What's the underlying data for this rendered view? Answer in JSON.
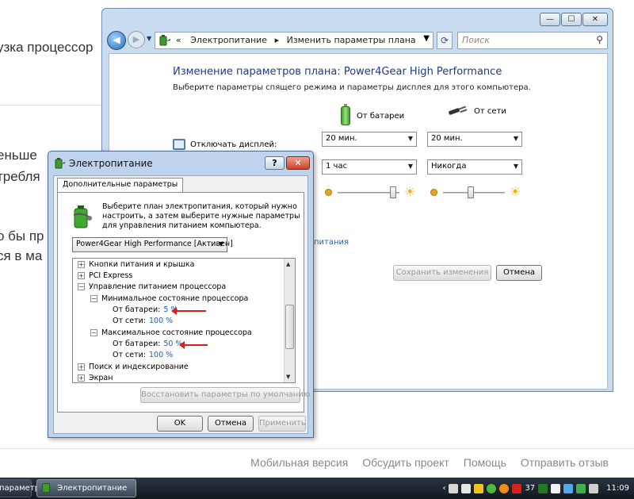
{
  "background_page": {
    "fragments": [
      "узка процессор",
      "еньше",
      "требля",
      "о бы пр",
      "ся в ма"
    ],
    "footer_links": [
      "Мобильная версия",
      "Обсудить проект",
      "Помощь",
      "Отправить отзыв"
    ]
  },
  "control_panel": {
    "caption_buttons": [
      "—",
      "☐",
      "✕"
    ],
    "breadcrumb_separator": "«",
    "address_items": [
      "Электропитание",
      "Изменить параметры плана"
    ],
    "address_arrow": "▸",
    "search_placeholder": "Поиск",
    "title": "Изменение параметров плана: Power4Gear High Performance",
    "subtitle": "Выберите параметры спящего режима и параметры дисплея для этого компьютера.",
    "col_battery": "От батареи",
    "col_ac": "От сети",
    "display_off_label": "Отключать дисплей:",
    "display_off_battery": "20 мин.",
    "display_off_ac": "20 мин.",
    "sleep_battery": "1 час",
    "sleep_ac": "Никогда",
    "brightness_battery_fraction": 0.9,
    "brightness_ac_fraction": 0.45,
    "partial_link": "питания",
    "save_button": "Сохранить изменения",
    "cancel_button": "Отмена"
  },
  "dialog": {
    "title": "Электропитание",
    "help_button": "?",
    "close_button": "✕",
    "tab": "Дополнительные параметры",
    "description": "Выберите план электропитания, который нужно настроить, а затем выберите нужные параметры для управления питанием компьютера.",
    "plan": "Power4Gear High Performance [Активен]",
    "tree": {
      "power_buttons": "Кнопки питания и крышка",
      "pci_express": "PCI Express",
      "cpu_management": "Управление питанием процессора",
      "min_state": "Минимальное состояние процессора",
      "min_battery_label": "От батареи:",
      "min_battery_value": "5 %",
      "min_ac_label": "От сети:",
      "min_ac_value": "100 %",
      "max_state": "Максимальное состояние процессора",
      "max_battery_label": "От батареи:",
      "max_battery_value": "50 %",
      "max_ac_label": "От сети:",
      "max_ac_value": "100 %",
      "search_indexing": "Поиск и индексирование",
      "screen": "Экран"
    },
    "restore_button": "Восстановить параметры по умолчанию",
    "ok_button": "OK",
    "cancel_button": "Отмена",
    "apply_button": "Применить"
  },
  "taskbar": {
    "item_left": "параметр...",
    "item_active": "Электропитание",
    "tray_number": "37",
    "tray_arrow": "‹",
    "clock": "11:09"
  }
}
